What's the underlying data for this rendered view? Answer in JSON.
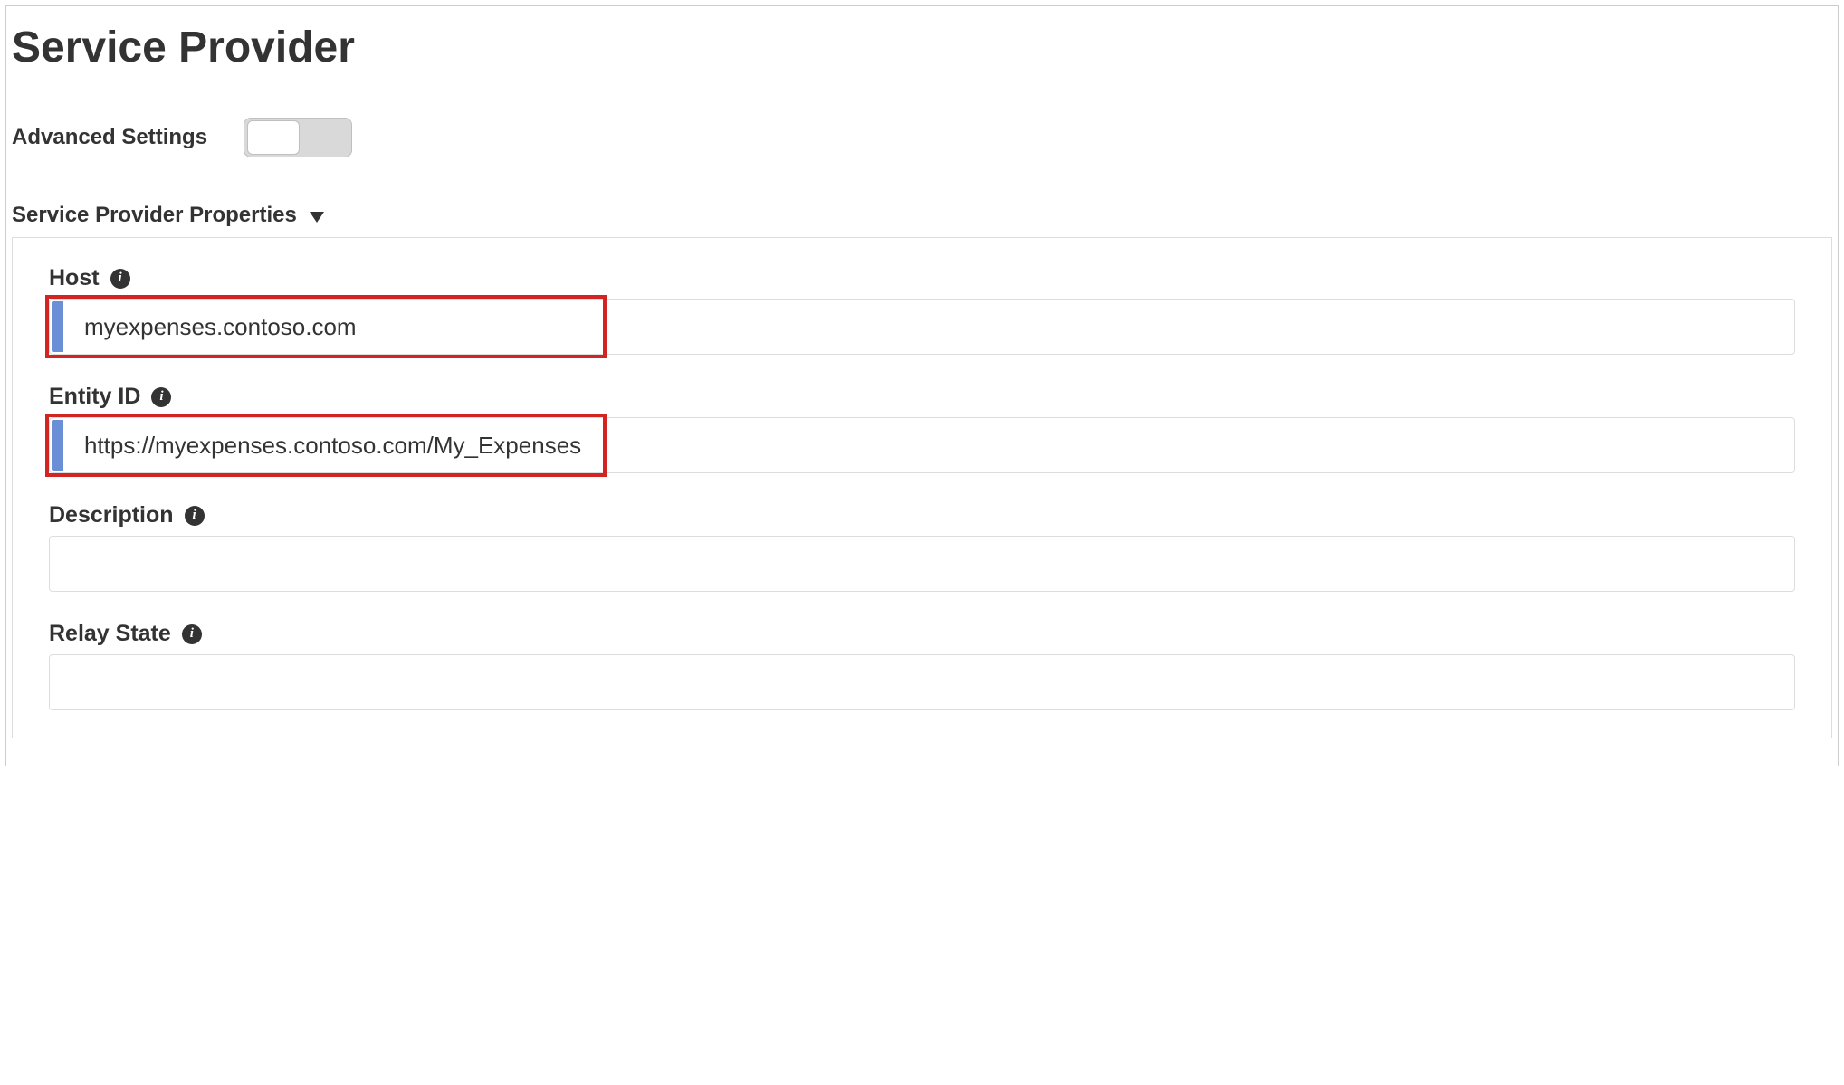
{
  "page": {
    "title": "Service Provider",
    "advancedLabel": "Advanced Settings",
    "sectionTitle": "Service Provider Properties"
  },
  "fields": {
    "host": {
      "label": "Host",
      "value": "myexpenses.contoso.com"
    },
    "entityId": {
      "label": "Entity ID",
      "value": "https://myexpenses.contoso.com/My_Expenses"
    },
    "description": {
      "label": "Description",
      "value": ""
    },
    "relayState": {
      "label": "Relay State",
      "value": ""
    }
  },
  "infoGlyph": "i"
}
